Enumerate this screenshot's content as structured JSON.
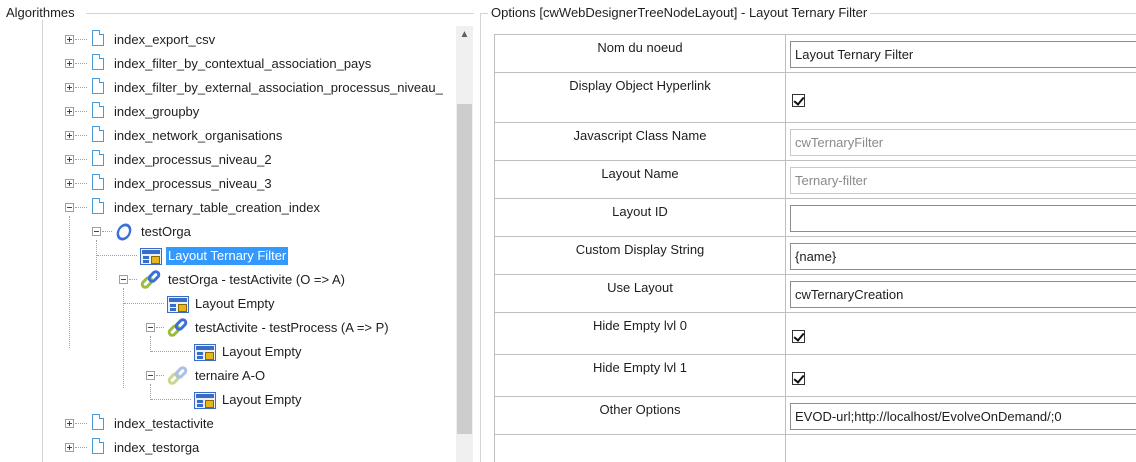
{
  "left_panel": {
    "title": "Algorithmes",
    "tree": [
      {
        "label": "index_export_csv",
        "icon": "document-icon",
        "expander": "plus"
      },
      {
        "label": "index_filter_by_contextual_association_pays",
        "icon": "document-icon",
        "expander": "plus"
      },
      {
        "label": "index_filter_by_external_association_processus_niveau_",
        "icon": "document-icon",
        "expander": "plus"
      },
      {
        "label": "index_groupby",
        "icon": "document-icon",
        "expander": "plus"
      },
      {
        "label": "index_network_organisations",
        "icon": "document-icon",
        "expander": "plus"
      },
      {
        "label": "index_processus_niveau_2",
        "icon": "document-icon",
        "expander": "plus"
      },
      {
        "label": "index_processus_niveau_3",
        "icon": "document-icon",
        "expander": "plus"
      },
      {
        "label": "index_ternary_table_creation_index",
        "icon": "document-icon",
        "expander": "minus"
      },
      {
        "label": "testOrga",
        "icon": "object-ring-icon",
        "expander": "minus"
      },
      {
        "label": "Layout Ternary Filter",
        "icon": "layout-icon",
        "selected": true
      },
      {
        "label": "testOrga - testActivite (O => A)",
        "icon": "association-link-icon",
        "expander": "minus"
      },
      {
        "label": "Layout Empty",
        "icon": "layout-icon"
      },
      {
        "label": "testActivite - testProcess (A => P)",
        "icon": "association-link-icon",
        "expander": "minus"
      },
      {
        "label": "Layout Empty",
        "icon": "layout-icon"
      },
      {
        "label": "ternaire A-O",
        "icon": "faded-association-link-icon",
        "expander": "minus"
      },
      {
        "label": "Layout Empty",
        "icon": "layout-icon"
      },
      {
        "label": "index_testactivite",
        "icon": "document-icon",
        "expander": "plus"
      },
      {
        "label": "index_testorga",
        "icon": "document-icon",
        "expander": "plus"
      }
    ]
  },
  "right_panel": {
    "title": "Options [cwWebDesignerTreeNodeLayout] - Layout Ternary Filter",
    "properties": [
      {
        "name": "Nom du noeud",
        "type": "text",
        "value": "Layout Ternary Filter"
      },
      {
        "name": "Display Object Hyperlink",
        "type": "checkbox",
        "checked": true
      },
      {
        "name": "Javascript Class Name",
        "type": "readonly",
        "value": "cwTernaryFilter"
      },
      {
        "name": "Layout Name",
        "type": "readonly",
        "value": "Ternary-filter"
      },
      {
        "name": "Layout ID",
        "type": "text",
        "value": ""
      },
      {
        "name": "Custom Display String",
        "type": "text",
        "value": "{name}"
      },
      {
        "name": "Use Layout",
        "type": "text",
        "value": "cwTernaryCreation"
      },
      {
        "name": "Hide Empty lvl 0",
        "type": "checkbox",
        "checked": true
      },
      {
        "name": "Hide Empty lvl 1",
        "type": "checkbox",
        "checked": true
      },
      {
        "name": "Other Options",
        "type": "text",
        "value": "EVOD-url;http://localhost/EvolveOnDemand/;0"
      },
      {
        "name": "",
        "type": "empty",
        "value": ""
      }
    ]
  }
}
